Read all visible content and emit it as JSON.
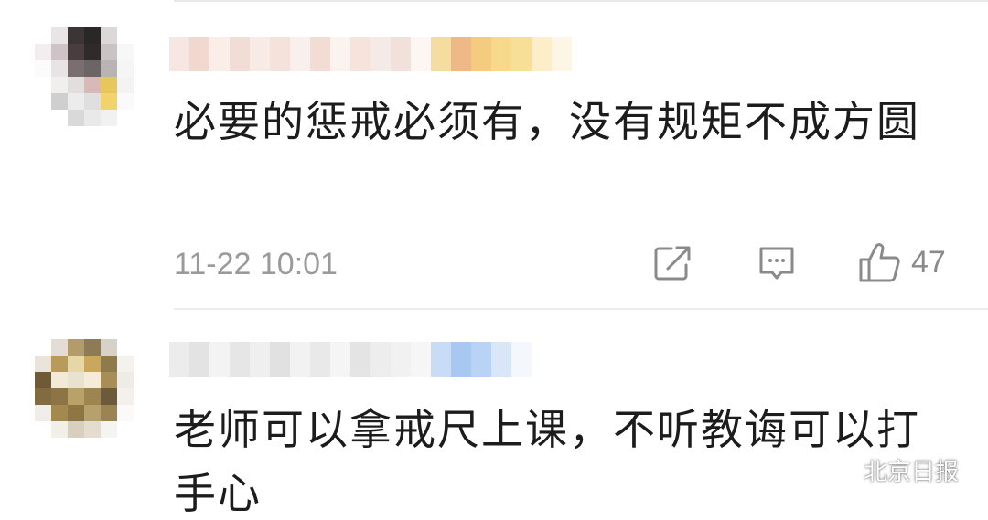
{
  "comments": [
    {
      "text": "必要的惩戒必须有，没有规矩不成方圆",
      "time": "11-22 10:01",
      "likes": "47"
    },
    {
      "text": "老师可以拿戒尺上课，不听教诲可以打手心"
    }
  ],
  "icons": {
    "share": "share-icon",
    "comment": "comment-icon",
    "like": "thumbs-up-icon",
    "watermark": "wechat-icon"
  },
  "watermark": {
    "label": "北京日报"
  },
  "colors": {
    "text": "#1c1c1c",
    "meta": "#9a9a9a",
    "icon": "#8a8a8a",
    "divider": "#ececec"
  }
}
